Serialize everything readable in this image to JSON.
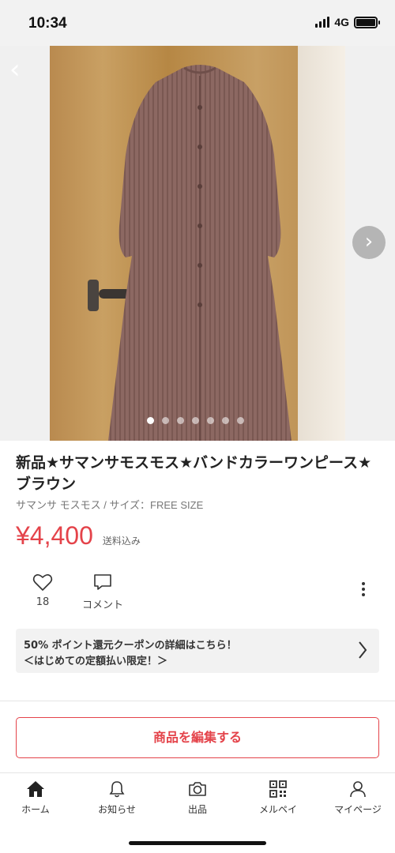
{
  "status_bar": {
    "time": "10:34",
    "network": "4G"
  },
  "gallery": {
    "image_count": 7,
    "active_index": 0
  },
  "product": {
    "title": "新品★サマンサモスモス★バンドカラーワンピース★ブラウン",
    "subtitle": "サマンサ モスモス / サイズ：FREE SIZE",
    "price": "¥4,400",
    "shipping": "送料込み"
  },
  "actions": {
    "like_count": "18",
    "comment_label": "コメント"
  },
  "coupon": {
    "line1": "50% ポイント還元クーポンの詳細はこちら！",
    "line2": "＜はじめての定額払い限定！＞"
  },
  "edit_button": {
    "label": "商品を編集する"
  },
  "tabbar": {
    "items": [
      {
        "label": "ホーム",
        "icon": "home-icon"
      },
      {
        "label": "お知らせ",
        "icon": "bell-icon"
      },
      {
        "label": "出品",
        "icon": "camera-icon"
      },
      {
        "label": "メルペイ",
        "icon": "qr-code-icon"
      },
      {
        "label": "マイページ",
        "icon": "person-icon"
      }
    ]
  },
  "colors": {
    "accent": "#e4434a",
    "dress": "#8a665f",
    "door": "#c29a5f"
  }
}
